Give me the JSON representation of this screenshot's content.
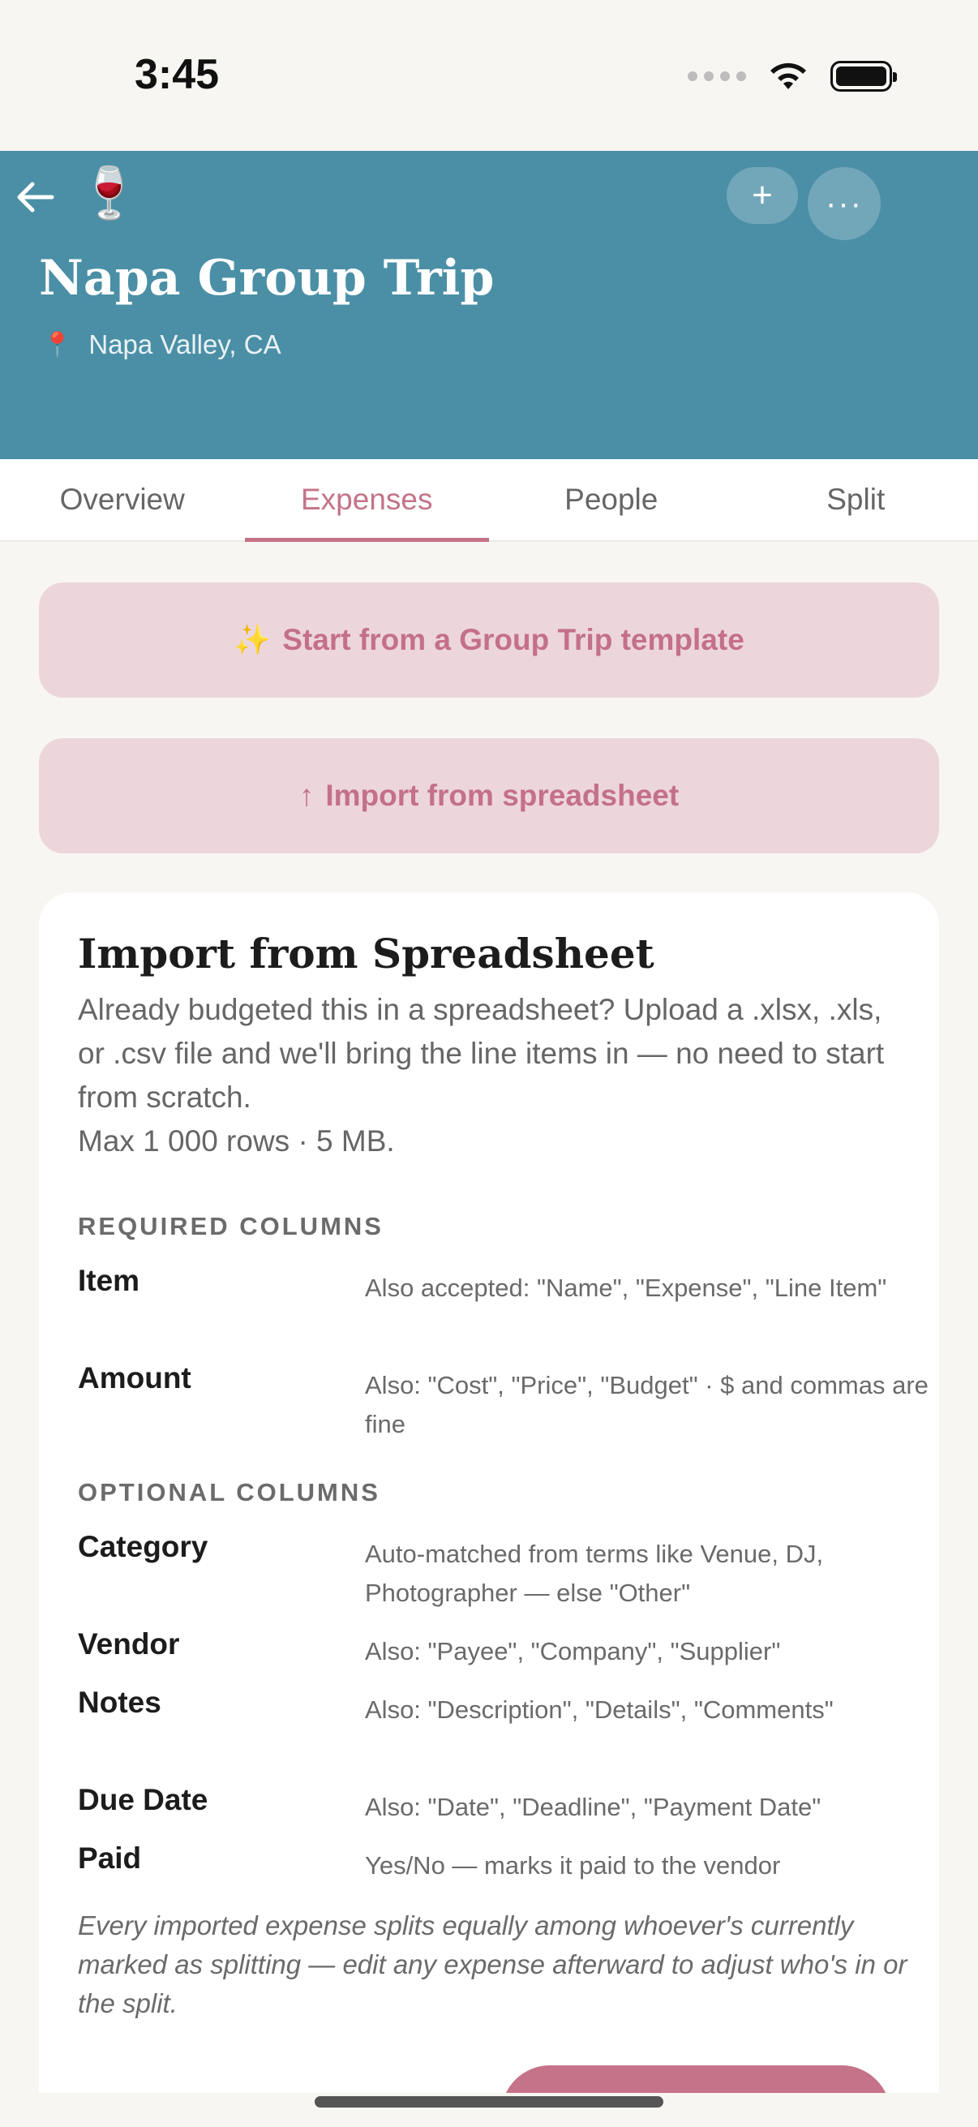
{
  "status_bar": {
    "time": "3:45"
  },
  "header": {
    "trip_emoji": "🍷",
    "title": "Napa Group Trip",
    "location_icon": "📍",
    "location": "Napa Valley, CA",
    "add_label": "+",
    "more_label": "···",
    "color": "#4b8fa6"
  },
  "tabs": [
    {
      "label": "Overview",
      "active": false
    },
    {
      "label": "Expenses",
      "active": true
    },
    {
      "label": "People",
      "active": false
    },
    {
      "label": "Split",
      "active": false
    }
  ],
  "actions": {
    "template_icon": "✨",
    "template_label": "Start from a Group Trip template",
    "import_icon": "↑",
    "import_label": "Import from spreadsheet"
  },
  "import_card": {
    "title": "Import from Spreadsheet",
    "description": "Already budgeted this in a spreadsheet? Upload a .xlsx, .xls, or .csv file and we'll bring the line items in — no need to start from scratch.",
    "limits": "Max 1 000 rows · 5 MB.",
    "required_label": "REQUIRED COLUMNS",
    "required_columns": [
      {
        "name": "Item",
        "desc": "Also accepted: \"Name\", \"Expense\", \"Line Item\""
      },
      {
        "name": "Amount",
        "desc": "Also: \"Cost\", \"Price\", \"Budget\" · $ and commas are fine"
      }
    ],
    "optional_label": "OPTIONAL COLUMNS",
    "optional_columns": [
      {
        "name": "Category",
        "desc": "Auto-matched from terms like Venue, DJ, Photographer — else \"Other\""
      },
      {
        "name": "Vendor",
        "desc": "Also: \"Payee\", \"Company\", \"Supplier\""
      },
      {
        "name": "Notes",
        "desc": "Also: \"Description\", \"Details\", \"Comments\""
      },
      {
        "name": "Due Date",
        "desc": "Also: \"Date\", \"Deadline\", \"Payment Date\""
      },
      {
        "name": "Paid",
        "desc": "Yes/No — marks it paid to the vendor"
      }
    ],
    "note": "Every imported expense splits equally among whoever's currently marked as splitting — edit any expense afterward to adjust who's in or the split."
  },
  "colors": {
    "accent": "#c47388",
    "accent_soft": "#ecd6dc",
    "background": "#f8f6f2"
  }
}
